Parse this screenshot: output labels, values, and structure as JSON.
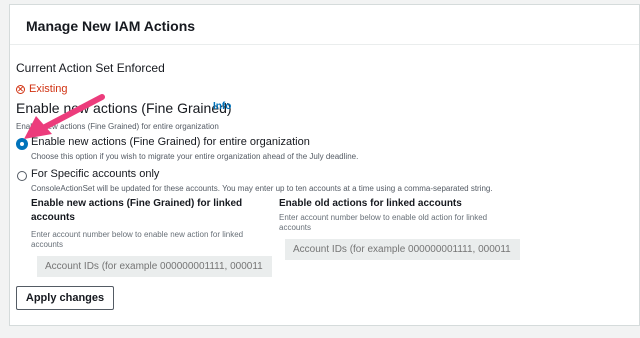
{
  "panel": {
    "title": "Manage New IAM Actions"
  },
  "current": {
    "title": "Current Action Set Enforced",
    "status": "Existing",
    "status_color": "#d13212"
  },
  "enable": {
    "heading": "Enable new actions (Fine Grained)",
    "info": "Info",
    "description": "Enable new actions (Fine Grained) for entire organization"
  },
  "options": [
    {
      "label": "Enable new actions (Fine Grained) for entire organization",
      "description": "Choose this option if you wish to migrate your entire organization ahead of the July deadline.",
      "selected": true
    },
    {
      "label": "For Specific accounts only",
      "description": "ConsoleActionSet will be updated for these accounts. You may enter up to ten accounts at a time using a comma-separated string.",
      "selected": false
    }
  ],
  "linked_new": {
    "title": "Enable new actions (Fine Grained) for linked accounts",
    "description": "Enter account number below to enable new action for linked accounts",
    "placeholder": "Account IDs (for example 000000001111, 000011"
  },
  "linked_old": {
    "title": "Enable old actions for linked accounts",
    "description": "Enter account number below to enable old action for linked accounts",
    "placeholder": "Account IDs (for example 000000001111, 000011"
  },
  "apply_label": "Apply changes",
  "colors": {
    "accent": "#0073bb",
    "annotation_arrow": "#ec3c7c"
  }
}
